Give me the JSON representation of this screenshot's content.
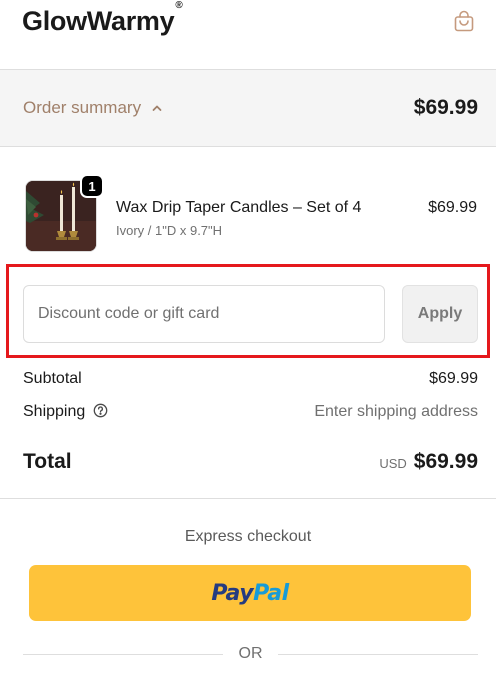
{
  "header": {
    "brand": "GlowWarmy",
    "trademark": "®",
    "cart_icon": "shopping-bag-icon"
  },
  "summary": {
    "toggle_label": "Order summary",
    "toggle_icon": "chevron-up-icon",
    "total": "$69.99"
  },
  "product": {
    "quantity": "1",
    "name": "Wax Drip Taper Candles – Set of 4",
    "variant": "Ivory / 1\"D x 9.7\"H",
    "price": "$69.99"
  },
  "discount": {
    "placeholder": "Discount code or gift card",
    "value": "",
    "apply_label": "Apply"
  },
  "totals": {
    "subtotal_label": "Subtotal",
    "subtotal_value": "$69.99",
    "shipping_label": "Shipping",
    "shipping_icon": "help-circle-icon",
    "shipping_value": "Enter shipping address",
    "total_label": "Total",
    "currency": "USD",
    "total_value": "$69.99"
  },
  "express": {
    "heading": "Express checkout",
    "paypal_pay": "Pay",
    "paypal_pal": "Pal",
    "or_label": "OR"
  },
  "colors": {
    "accent_brown": "#a0806a",
    "highlight_red": "#e5181c",
    "paypal_yellow": "#fec33a",
    "paypal_dark_blue": "#253b80",
    "paypal_light_blue": "#179bd7"
  }
}
